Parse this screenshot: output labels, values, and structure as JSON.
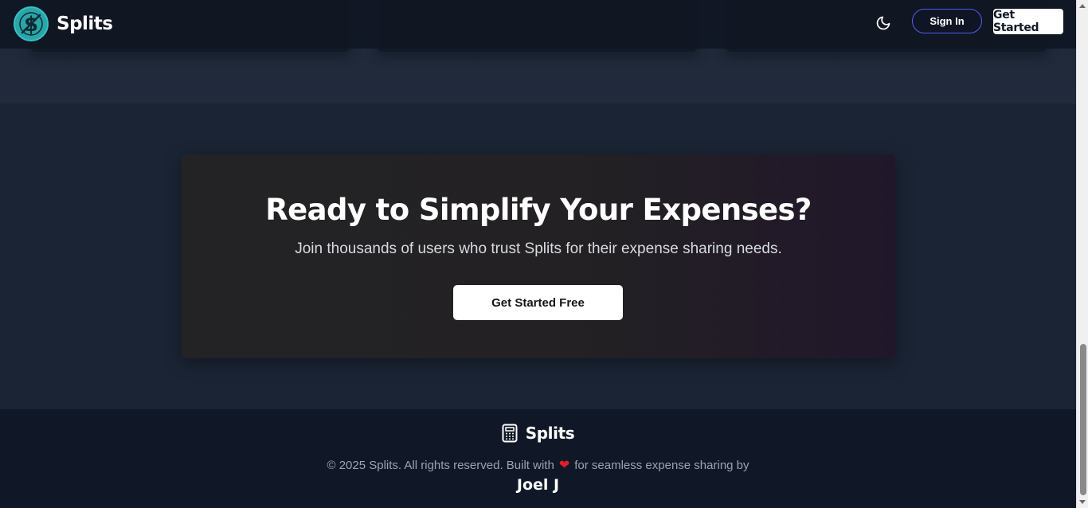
{
  "navbar": {
    "brand_name": "Splits",
    "logo_icon": "dollar-slash-icon",
    "theme_icon": "moon-icon",
    "signin_label": "Sign In",
    "get_started_label": "Get Started"
  },
  "cta": {
    "title": "Ready to Simplify Your Expenses?",
    "subtitle": "Join thousands of users who trust Splits for their expense sharing needs.",
    "button_label": "Get Started Free"
  },
  "footer": {
    "brand_name": "Splits",
    "brand_icon": "calculator-icon",
    "copyright_before": "© 2025 Splits. All rights reserved. Built with",
    "copyright_after": "for seamless expense sharing by",
    "author": "Joel J"
  },
  "colors": {
    "accent_teal": "#2aa5a8",
    "signin_border": "#4f5ff0",
    "heart": "#e11d2a",
    "footer_bg": "#101828",
    "page_bg": "#1b2434"
  }
}
